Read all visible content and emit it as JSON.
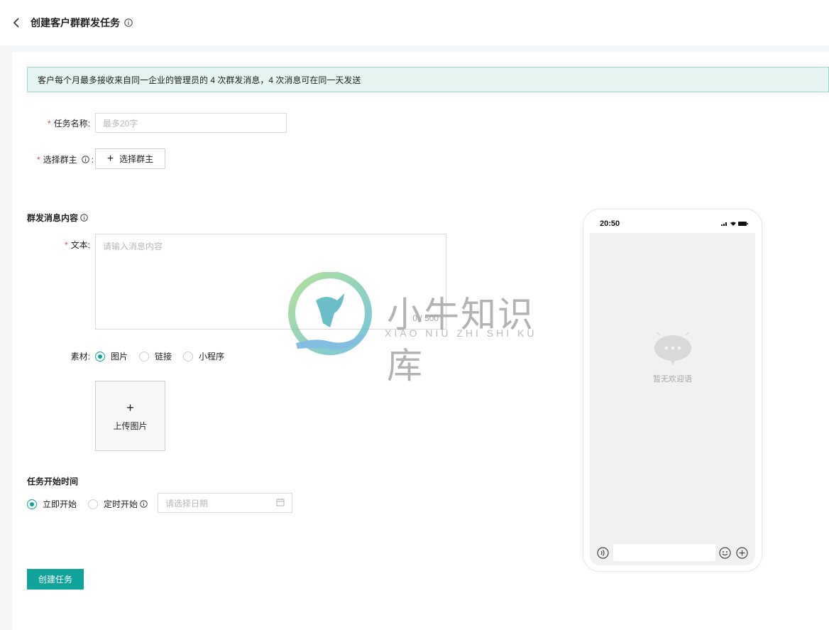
{
  "header": {
    "title": "创建客户群群发任务"
  },
  "notice": "客户每个月最多接收来自同一企业的管理员的 4 次群发消息，4 次消息可在同一天发送",
  "form": {
    "task_name_label": "任务名称:",
    "task_name_placeholder": "最多20字",
    "owner_label": "选择群主",
    "owner_colon": ":",
    "owner_button": "选择群主",
    "message_section": "群发消息内容",
    "text_label": "文本:",
    "text_placeholder": "请输入消息内容",
    "text_counter": "0 / 500",
    "material_label": "素材:",
    "material_options": [
      "图片",
      "链接",
      "小程序"
    ],
    "material_selected": "图片",
    "upload_label": "上传图片",
    "start_section": "任务开始时间",
    "start_options": [
      "立即开始",
      "定时开始"
    ],
    "start_selected": "立即开始",
    "date_placeholder": "请选择日期",
    "submit": "创建任务"
  },
  "preview": {
    "time": "20:50",
    "empty_text": "暂无欢迎语"
  },
  "watermark": {
    "title": "小牛知识库",
    "subtitle": "XIAO NIU ZHI SHI KU"
  },
  "colors": {
    "accent": "#10a39a",
    "notice_bg": "#e6f4f2",
    "required": "#e14b4b"
  }
}
